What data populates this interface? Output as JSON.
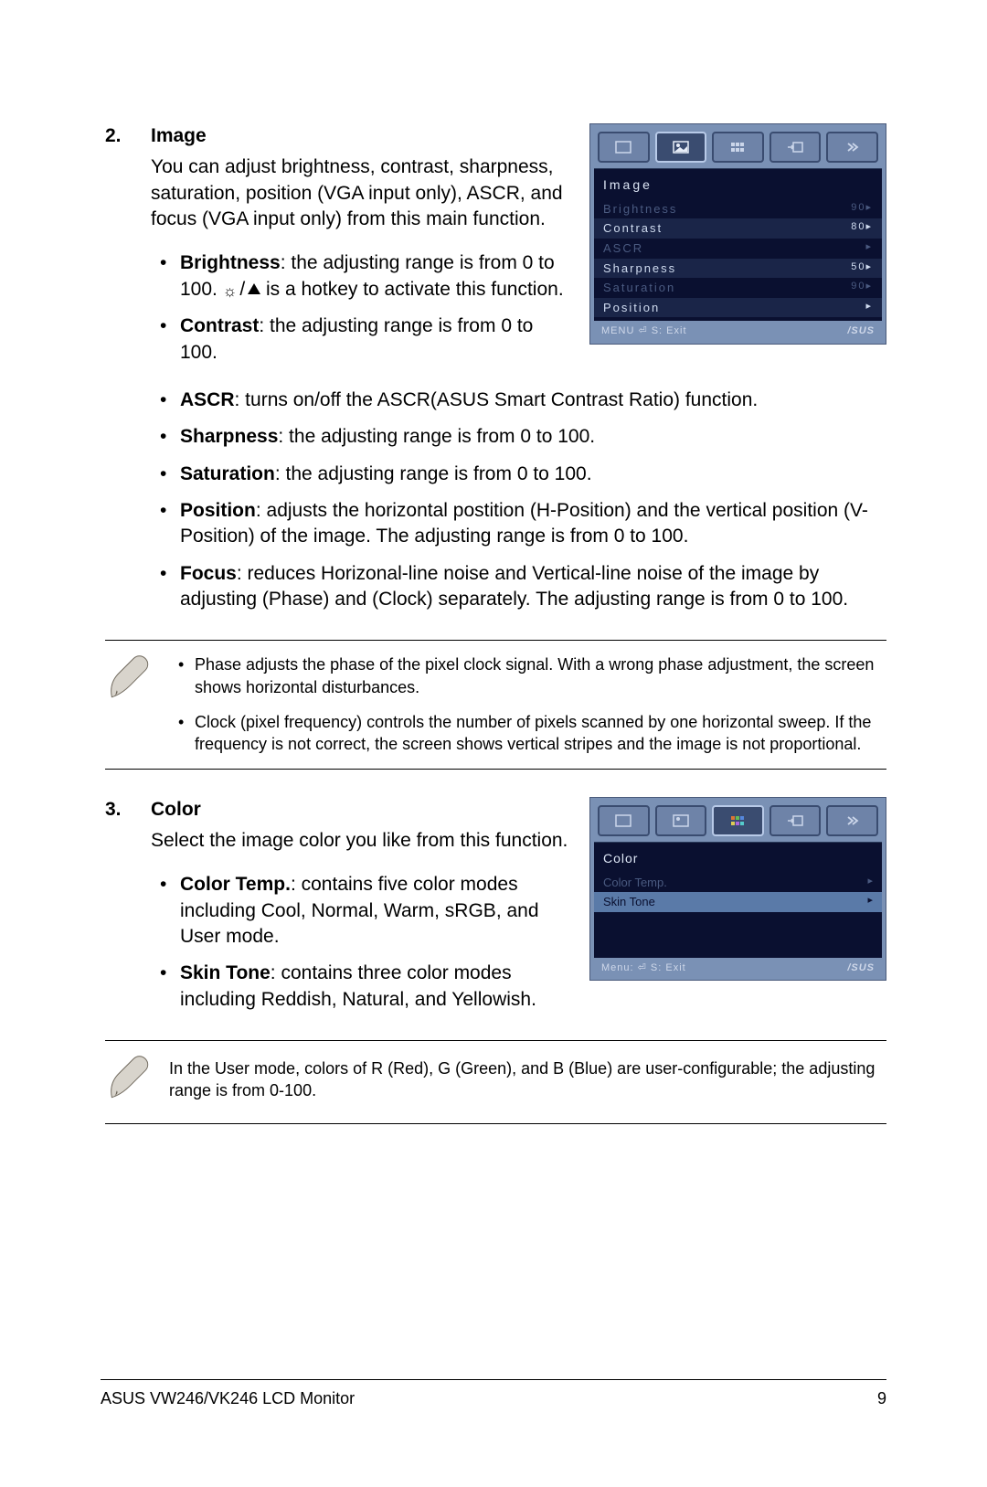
{
  "s2": {
    "number": "2.",
    "title": "Image",
    "intro": "You can adjust brightness, contrast, sharpness, saturation, position (VGA input only), ASCR, and focus (VGA input only) from this main function.",
    "items": {
      "brightness": {
        "label": "Brightness",
        "text_a": ": the adjusting range is from 0 to 100. ",
        "text_b": " is a hotkey to activate this function."
      },
      "contrast": {
        "label": "Contrast",
        "text": ": the adjusting range is from 0 to 100."
      },
      "ascr": {
        "label": "ASCR",
        "text": ": turns on/off the ASCR(ASUS Smart Contrast Ratio) function."
      },
      "sharpness": {
        "label": "Sharpness",
        "text": ": the adjusting range is from 0 to 100."
      },
      "saturation": {
        "label": "Saturation",
        "text": ": the adjusting range is from 0 to 100."
      },
      "position": {
        "label": "Position",
        "text": ": adjusts the horizontal postition (H-Position) and the vertical position (V-Position) of the image. The adjusting range is from 0 to 100."
      },
      "focus": {
        "label": "Focus",
        "text": ": reduces Horizonal-line noise and Vertical-line noise of the image by adjusting (Phase) and (Clock) separately. The adjusting range is from 0 to 100."
      }
    },
    "notes": {
      "phase": "Phase adjusts the phase of the pixel clock signal. With a wrong phase adjustment, the screen shows  horizontal disturbances.",
      "clock": "Clock (pixel frequency) controls the number of pixels scanned by one horizontal sweep. If the frequency is not correct, the screen shows vertical stripes and the image is not proportional."
    },
    "osd": {
      "heading": "Image",
      "rows": [
        {
          "l": "Brightness",
          "r": "90▸"
        },
        {
          "l": "Contrast",
          "r": "80▸"
        },
        {
          "l": "ASCR",
          "r": "▸"
        },
        {
          "l": "Sharpness",
          "r": "50▸"
        },
        {
          "l": "Saturation",
          "r": "90▸"
        },
        {
          "l": "Position",
          "r": "▸"
        }
      ],
      "foot_l": "MENU ⏎   S: Exit",
      "foot_r": "/SUS"
    }
  },
  "s3": {
    "number": "3.",
    "title": "Color",
    "intro": "Select the image color you like from this function.",
    "items": {
      "colortemp": {
        "label": "Color Temp.",
        "text": ": contains five color modes including Cool, Normal, Warm, sRGB, and User mode."
      },
      "skintone": {
        "label": "Skin Tone",
        "text": ": contains three color modes including Reddish, Natural, and Yellowish."
      }
    },
    "note": "In the User mode, colors of R (Red), G (Green), and B (Blue) are user-configurable; the adjusting range is from 0-100.",
    "osd": {
      "heading": "Color",
      "rows": [
        {
          "l": "Color Temp.",
          "r": "▸"
        },
        {
          "l": "Skin Tone",
          "r": "▸"
        }
      ],
      "foot_l": "Menu: ⏎   S: Exit",
      "foot_r": "/SUS"
    }
  },
  "footer": {
    "left": "ASUS VW246/VK246 LCD Monitor",
    "right": "9"
  }
}
